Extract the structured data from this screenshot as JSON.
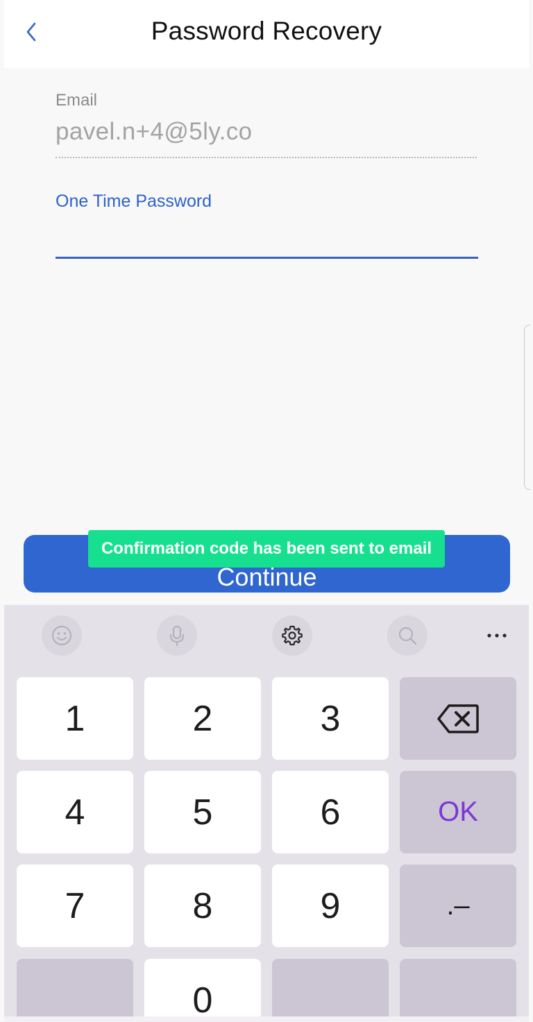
{
  "header": {
    "title": "Password Recovery",
    "back_icon": "chevron-left-icon"
  },
  "form": {
    "email_label": "Email",
    "email_value": "pavel.n+4@5ly.co",
    "otp_label": "One Time Password",
    "otp_value": ""
  },
  "actions": {
    "continue_label": "Continue"
  },
  "toast": {
    "message": "Confirmation code has been sent to email"
  },
  "keyboard": {
    "toolbar": [
      "emoji-icon",
      "microphone-icon",
      "settings-icon",
      "search-icon",
      "more-icon"
    ],
    "keys": {
      "k1": "1",
      "k2": "2",
      "k3": "3",
      "k4": "4",
      "k5": "5",
      "k6": "6",
      "k7": "7",
      "k8": "8",
      "k9": "9",
      "k0": "0",
      "ok": "OK",
      "dot_dash": ".–"
    }
  },
  "colors": {
    "accent": "#2f66cf",
    "toast": "#16e08f",
    "ok_key": "#7a37d6"
  }
}
